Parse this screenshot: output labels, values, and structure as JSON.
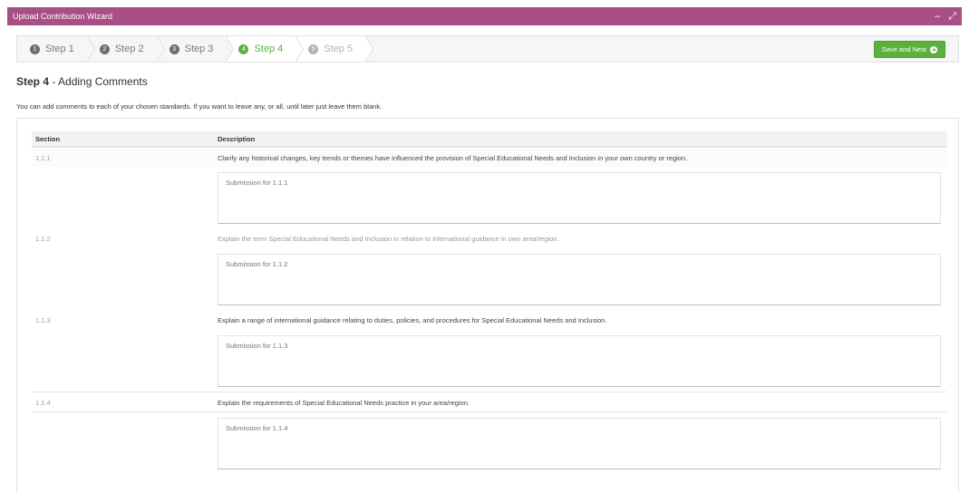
{
  "window": {
    "title": "Upload Contribution Wizard",
    "minimize_glyph": "–",
    "expand_glyph": "⤢"
  },
  "steps": [
    {
      "num": "1",
      "label": "Step 1",
      "state": "done"
    },
    {
      "num": "2",
      "label": "Step 2",
      "state": "done"
    },
    {
      "num": "3",
      "label": "Step 3",
      "state": "done"
    },
    {
      "num": "4",
      "label": "Step 4",
      "state": "active"
    },
    {
      "num": "5",
      "label": "Step 5",
      "state": "disabled"
    }
  ],
  "toolbar": {
    "save_label": "Save and Next",
    "save_icon": "arrow-right-circle-icon"
  },
  "page": {
    "step_label": "Step 4",
    "step_title": " - Adding Comments",
    "intro": "You can add comments to each of your chosen standards. If you want to leave any, or all, until later just leave them blank."
  },
  "table": {
    "headers": {
      "section": "Section",
      "description": "Description"
    },
    "rows": [
      {
        "section": "1.1.1",
        "description": "Clarify any historical changes, key trends or themes have influenced the provision of Special Educational Needs and Inclusion in your own country or region.",
        "placeholder": "Submission for 1.1.1"
      },
      {
        "section": "1.1.2",
        "description": "Explain the term Special Educational Needs and Inclusion in relation to international guidance in own area/region.",
        "placeholder": "Submission for 1.1.2"
      },
      {
        "section": "1.1.3",
        "description": "Explain a range of international guidance relating to duties, policies, and procedures for Special Educational Needs and Inclusion.",
        "placeholder": "Submission for 1.1.3"
      },
      {
        "section": "1.1.4",
        "description": "Explain the requirements of Special Educational Needs practice in your area/region.",
        "placeholder": "Submission for 1.1.4"
      }
    ]
  },
  "colors": {
    "titlebar": "#a84f86",
    "accent_green": "#5cb13d",
    "link_blue": "#7fa8c6"
  }
}
